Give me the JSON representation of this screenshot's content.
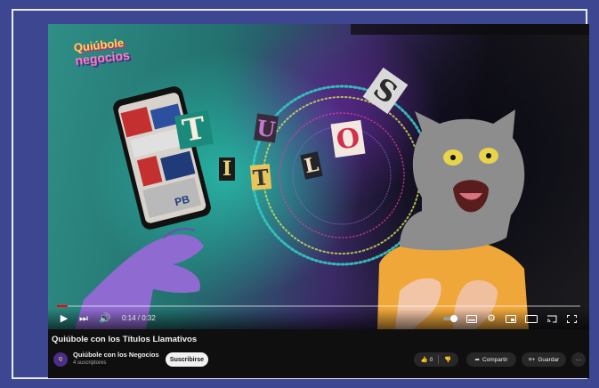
{
  "video": {
    "logo_line1": "Quiúbole",
    "logo_line2": "negocios",
    "letters": [
      "T",
      "I",
      "T",
      "U",
      "L",
      "O",
      "S"
    ],
    "time": "0:14 / 0:32",
    "progress": 0.02
  },
  "info": {
    "title": "Quiúbole con los Títulos Llamativos",
    "channel": "Quiúbole con los Negocios",
    "subscribers": "4 suscriptores",
    "avatar_text": "Q",
    "subscribe_label": "Suscribirse",
    "likes": "0",
    "share_label": "Compartir",
    "save_label": "Guardar",
    "more_label": "···"
  },
  "colors": {
    "background": "#3d4691",
    "accent_red": "#ff0000"
  }
}
